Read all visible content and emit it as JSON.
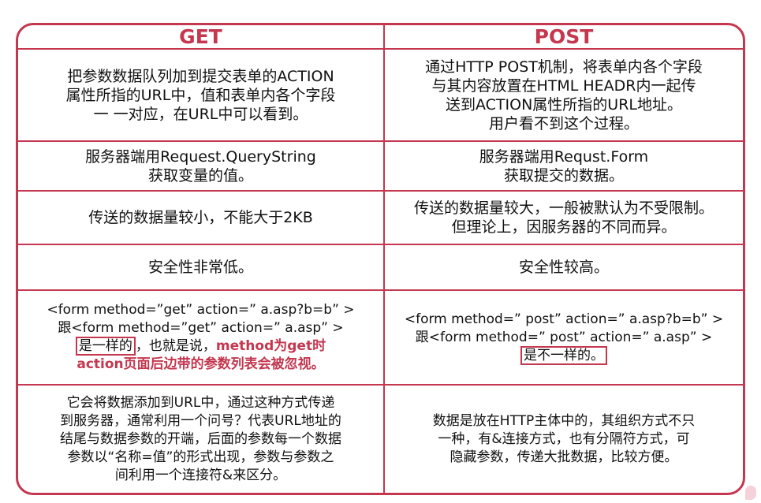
{
  "header": {
    "get": "GET",
    "post": "POST"
  },
  "rows": [
    {
      "get": [
        "把参数数据队列加到提交表单的ACTION",
        "属性所指的URL中，值和表单内各个字段",
        "一 一对应，在URL中可以看到。"
      ],
      "post": [
        "通过HTTP POST机制，将表单内各个字段",
        "与其内容放置在HTML HEADR内一起传",
        "送到ACTION属性所指的URL地址。",
        "用户看不到这个过程。"
      ]
    },
    {
      "get": [
        "服务器端用Request.QueryString",
        "获取变量的值。"
      ],
      "post": [
        "服务器端用Requst.Form",
        "获取提交的数据。"
      ]
    },
    {
      "get": [
        "传送的数据量较小，不能大于2KB"
      ],
      "post": [
        "传送的数据量较大，一般被默认为不受限制。",
        "但理论上，因服务器的不同而异。"
      ]
    },
    {
      "get": [
        "安全性非常低。"
      ],
      "post": [
        "安全性较高。"
      ]
    }
  ],
  "form_row": {
    "get_line1": "<form method=”get” action=” a.asp?b=b” >",
    "get_line2": "跟<form method=”get” action=” a.asp” >",
    "get_boxed": "是一样的",
    "get_mid": "，也就是说，",
    "get_red1": "method为get时",
    "get_red2": "action页面后边带的参数列表会被忽视。",
    "post_line1": "<form method=” post” action=” a.asp?b=b” >",
    "post_line2": "跟<form method=” post” action=” a.asp” >",
    "post_boxed": "是不一样的。"
  },
  "last_row": {
    "get": [
      "它会将数据添加到URL中，通过这种方式传递",
      "到服务器，通常利用一个问号？代表URL地址的",
      "结尾与数据参数的开端，后面的参数每一个数据",
      "参数以“名称=值”的形式出现，参数与参数之",
      "间利用一个连接符&来区分。"
    ],
    "post": [
      "数据是放在HTTP主体中的，其组织方式不只",
      "一种，有&连接方式，也有分隔符方式，可",
      "隐藏参数，传递大批数据，比较方便。"
    ]
  },
  "colors": {
    "accent": "#c4374f"
  }
}
